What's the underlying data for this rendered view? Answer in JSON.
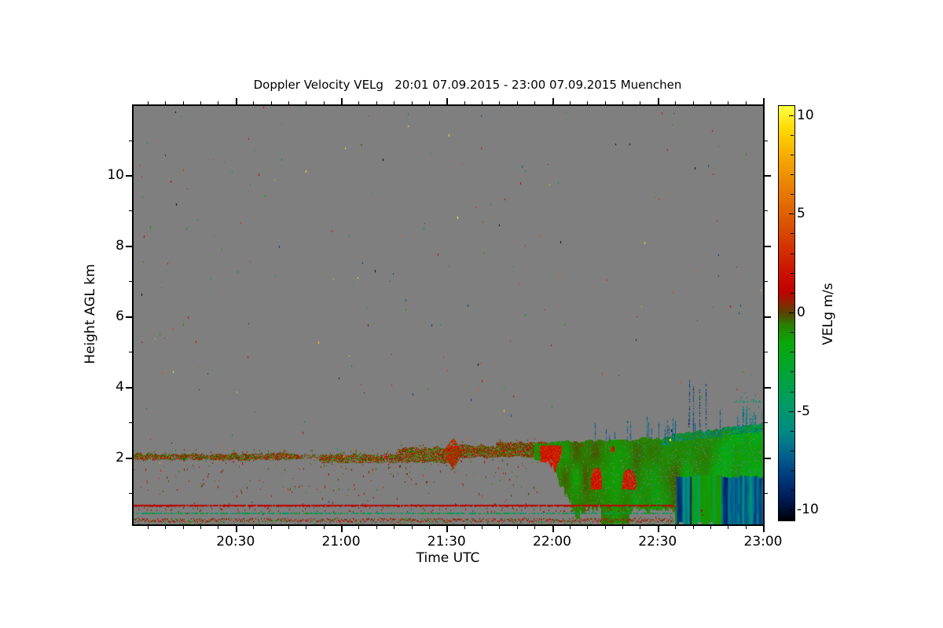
{
  "chart_data": {
    "type": "heatmap",
    "title": "Doppler Velocity VELg   20:01 07.09.2015 - 23:00 07.09.2015 Muenchen",
    "station": "Muenchen",
    "time_start": "20:01 07.09.2015",
    "time_end": "23:00 07.09.2015",
    "axes": {
      "x": {
        "label": "Time UTC",
        "start_min": 0,
        "end_min": 179,
        "ticks": [
          {
            "min": 29,
            "label": "20:30"
          },
          {
            "min": 59,
            "label": "21:00"
          },
          {
            "min": 89,
            "label": "21:30"
          },
          {
            "min": 119,
            "label": "22:00"
          },
          {
            "min": 149,
            "label": "22:30"
          },
          {
            "min": 179,
            "label": "23:00"
          }
        ],
        "minor_step_min": 5
      },
      "y": {
        "label": "Height AGL km",
        "lim": [
          0.1,
          11.97
        ],
        "ticks": [
          {
            "v": 2,
            "label": "2"
          },
          {
            "v": 4,
            "label": "4"
          },
          {
            "v": 6,
            "label": "6"
          },
          {
            "v": 8,
            "label": "8"
          },
          {
            "v": 10,
            "label": "10"
          }
        ],
        "minor_step": 1
      }
    },
    "colorbar": {
      "label": "VELg m/s",
      "lim": [
        -10.5,
        10.5
      ],
      "ticks": [
        {
          "v": 10,
          "label": "10"
        },
        {
          "v": 5,
          "label": "5"
        },
        {
          "v": 0,
          "label": "0"
        },
        {
          "v": -5,
          "label": "-5"
        },
        {
          "v": -10,
          "label": "-10"
        }
      ],
      "minor_step": 1,
      "stops": [
        [
          10.5,
          "#FFFF42"
        ],
        [
          9.3,
          "#FFD800"
        ],
        [
          8.0,
          "#F6AC00"
        ],
        [
          6.5,
          "#E98300"
        ],
        [
          5.0,
          "#DE5F00"
        ],
        [
          3.5,
          "#D43700"
        ],
        [
          2.0,
          "#CB1000"
        ],
        [
          1.1,
          "#C00000"
        ],
        [
          0.5,
          "#8C2600"
        ],
        [
          0.0,
          "#564400"
        ],
        [
          -0.6,
          "#2A7E00"
        ],
        [
          -1.5,
          "#0AA80A"
        ],
        [
          -3.0,
          "#00A435"
        ],
        [
          -4.5,
          "#009C62"
        ],
        [
          -6.0,
          "#008A84"
        ],
        [
          -7.2,
          "#00628E"
        ],
        [
          -8.3,
          "#003A7E"
        ],
        [
          -9.2,
          "#001F5E"
        ],
        [
          -10.0,
          "#000D30"
        ],
        [
          -10.5,
          "#000004"
        ]
      ]
    },
    "plot": {
      "no_data_gray": "#7F7F7F",
      "seed": 1337,
      "noise_speckles": 230,
      "band": {
        "segments": [
          {
            "t": [
              0,
              48
            ],
            "top": 2.1,
            "bot": 1.94,
            "density": 0.8
          },
          {
            "t": [
              48,
              53
            ],
            "top": 2.07,
            "bot": 1.96,
            "density": 0.35
          },
          {
            "t": [
              53,
              75
            ],
            "top": 2.1,
            "bot": 1.93,
            "density": 0.75,
            "strand2": [
              1.96,
              1.84
            ]
          },
          {
            "t": [
              75,
              92
            ],
            "top": 2.28,
            "bot": 1.86,
            "density": 0.8
          },
          {
            "t": [
              92,
              103
            ],
            "top": 2.33,
            "bot": 2.0,
            "density": 0.8
          },
          {
            "t": [
              103,
              119
            ],
            "top": 2.44,
            "bot": 2.02,
            "density": 0.85
          }
        ],
        "blob": {
          "t": [
            88,
            93.5
          ],
          "top": 2.55,
          "bot": 1.65
        },
        "subspeckle_zone": {
          "t": [
            0,
            116
          ],
          "h": [
            0.72,
            1.95
          ]
        }
      },
      "mass": {
        "t_range": [
          114,
          179.5
        ],
        "top_profile": [
          [
            114,
            2.4
          ],
          [
            124,
            2.45
          ],
          [
            140,
            2.5
          ],
          [
            150,
            2.55
          ],
          [
            158,
            2.7
          ],
          [
            166,
            2.8
          ],
          [
            173,
            2.9
          ],
          [
            179.5,
            3.0
          ]
        ],
        "descend_t": [
          118,
          127
        ],
        "orange_t": [
          114,
          150
        ],
        "orange_h": [
          1.1,
          2.35
        ],
        "teal_top_t": 140,
        "holes": [
          {
            "t": [
              127,
              133
            ],
            "h": 0.55
          },
          {
            "t": [
              141,
              153.8
            ],
            "h": 0.5
          }
        ]
      },
      "precip": {
        "blocks": [
          [
            154.5,
            158.7
          ],
          [
            167,
            179.5
          ]
        ],
        "gap": [
          158.7,
          167
        ],
        "top": 1.45,
        "notches": [
          [
            155,
            156.2
          ],
          [
            160.5,
            161.6
          ],
          [
            163.8,
            164.6
          ]
        ]
      },
      "lines": {
        "t_end": 153.4,
        "red_h": [
          0.6,
          0.66
        ],
        "teal_h": 0.435,
        "upper_h": [
          0.47,
          0.6
        ],
        "dense_h": [
          0.19,
          0.29
        ],
        "low_h": [
          0.1,
          0.18
        ]
      },
      "spikes": {
        "cluster_t": [
          151,
          154.5
        ],
        "cluster_h": [
          2.4,
          3.3
        ],
        "tall_t": [
          157,
          166
        ],
        "right_teal_t": 171,
        "teal_row_h": 3.6,
        "yellow_dot": [
          152.3,
          2.52
        ],
        "black_dot": [
          152.9,
          2.8
        ]
      }
    }
  }
}
